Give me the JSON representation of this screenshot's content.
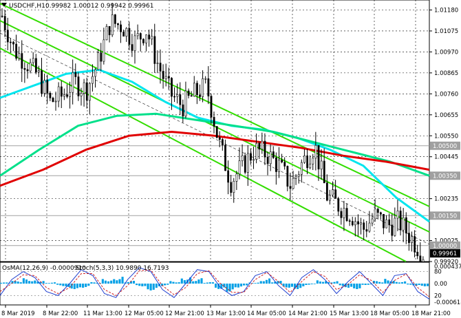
{
  "header": {
    "symbol": "USDCHF,H1",
    "ohlc": "0.99982 1.00012 0.99942 0.99961"
  },
  "oscillator_header": {
    "osma": "OsMA(12,26,9) -0.0000910",
    "stoch": "Stoch(5,3,3) 10.9890 16.7193"
  },
  "price_axis": [
    "1.01180",
    "1.01075",
    "1.00970",
    "1.00865",
    "1.00760",
    "1.00655",
    "1.00550",
    "1.00445",
    "1.00235",
    "1.00025",
    "0.99920"
  ],
  "level_tags": [
    "1.00500",
    "1.00350",
    "1.00150",
    "1.00000"
  ],
  "current_price": "0.99961",
  "osc_axis": {
    "top": "0.0004378",
    "upper": "80",
    "zero": "0.00",
    "lower": "20",
    "bottom": "-0.000618"
  },
  "time_axis": [
    "8 Mar 2019",
    "8 Mar 22:00",
    "11 Mar 13:00",
    "12 Mar 05:00",
    "12 Mar 21:00",
    "13 Mar 13:00",
    "14 Mar 05:00",
    "14 Mar 21:00",
    "15 Mar 13:00",
    "18 Mar 05:00",
    "18 Mar 21:00"
  ],
  "colors": {
    "bull_bar": "#000000",
    "ma_fast": "#00e5ee",
    "ma_mid": "#00e08a",
    "ma_slow": "#e00000",
    "channel": "#33dd00",
    "grid": "#000000",
    "level_line": "#a0a0a0",
    "osma_hist": "#00a0e6",
    "stoch_main": "#1f3fd0",
    "stoch_signal": "#d02020",
    "tag_bg": "#a0a0a0",
    "price_tag_bg": "#000000"
  },
  "chart_data": {
    "type": "candlestick",
    "instrument": "USDCHF",
    "timeframe": "H1",
    "ylim": [
      0.9992,
      1.0123
    ],
    "horizontal_levels": [
      1.005,
      1.0035,
      1.0015,
      1.0
    ],
    "price_path": [
      1.0115,
      1.0098,
      1.0092,
      1.0085,
      1.0072,
      1.0075,
      1.0082,
      1.0078,
      1.0092,
      1.0112,
      1.011,
      1.0102,
      1.0108,
      1.009,
      1.0076,
      1.007,
      1.0076,
      1.008,
      1.0052,
      1.0032,
      1.004,
      1.0048,
      1.0046,
      1.004,
      1.003,
      1.0042,
      1.005,
      1.0025,
      1.002,
      1.0016,
      1.0008,
      1.0015,
      1.001,
      1.0012,
      1.0004,
      0.9996
    ],
    "series": [
      {
        "name": "",
        "type": "sma_fast",
        "values": [
          1.0074,
          1.008,
          1.0086,
          1.0088,
          1.0082,
          1.0072,
          1.0064,
          1.006,
          1.0058,
          1.0054,
          1.0048,
          1.004,
          1.0024,
          1.0012
        ]
      },
      {
        "name": "",
        "type": "sma_mid",
        "values": [
          1.0035,
          1.0048,
          1.006,
          1.0065,
          1.0066,
          1.0063,
          1.006,
          1.0057,
          1.0052,
          1.0047,
          1.0042,
          1.0035
        ]
      },
      {
        "name": "",
        "type": "sma_slow",
        "values": [
          1.003,
          1.0038,
          1.0048,
          1.0055,
          1.0057,
          1.0055,
          1.0052,
          1.0049,
          1.0045,
          1.0042,
          1.0038
        ]
      }
    ],
    "oscillator": {
      "osma_hist": [
        0.4,
        1,
        2,
        1.5,
        0.5,
        -1,
        -2,
        -1.5,
        0.5,
        2,
        3,
        1,
        -1,
        -2.5,
        -1,
        1,
        3,
        2,
        0.5,
        -2,
        -3,
        -1.5,
        0.5,
        2,
        1,
        -1.5,
        -2,
        -0.5,
        1.5,
        1,
        -1.5,
        -2,
        -0.5,
        1,
        2,
        1,
        -0.8,
        -1
      ],
      "stoch_main": [
        20,
        60,
        80,
        65,
        30,
        20,
        50,
        85,
        70,
        25,
        15,
        60,
        90,
        80,
        35,
        15,
        50,
        85,
        80,
        40,
        20,
        30,
        70,
        80,
        45,
        20,
        65,
        85,
        60,
        25,
        55,
        80,
        50,
        20,
        70,
        75,
        30,
        11
      ],
      "stoch_signal": [
        30,
        50,
        72,
        70,
        40,
        25,
        40,
        75,
        75,
        35,
        20,
        45,
        82,
        84,
        45,
        22,
        40,
        75,
        82,
        50,
        28,
        28,
        60,
        78,
        55,
        28,
        55,
        80,
        68,
        35,
        48,
        72,
        58,
        28,
        58,
        74,
        40,
        17
      ]
    }
  }
}
